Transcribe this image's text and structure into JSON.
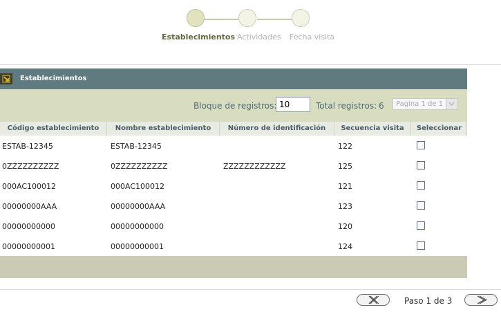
{
  "wizard": {
    "steps": [
      {
        "label": "Establecimientos",
        "state": "active"
      },
      {
        "label": "Actividades",
        "state": "inactive"
      },
      {
        "label": "Fecha visita",
        "state": "inactive"
      }
    ]
  },
  "panel": {
    "title": "Establecimientos",
    "icon": "expand-corner-icon"
  },
  "toolbar": {
    "block_label": "Bloque de registros:",
    "block_value": "10",
    "total_label": "Total registros:",
    "total_value": "6",
    "page_select": "Pagina 1 de 1"
  },
  "table": {
    "columns": [
      "Código establecimiento",
      "Nombre establecimiento",
      "Número de identificación",
      "Secuencia visita",
      "Seleccionar"
    ],
    "rows": [
      {
        "codigo": "ESTAB-12345",
        "nombre": "ESTAB-12345",
        "numero": "",
        "secuencia": "122",
        "checked": false
      },
      {
        "codigo": "0ZZZZZZZZZZ",
        "nombre": "0ZZZZZZZZZZ",
        "numero": "ZZZZZZZZZZZZ",
        "secuencia": "125",
        "checked": false
      },
      {
        "codigo": "000AC100012",
        "nombre": "000AC100012",
        "numero": "",
        "secuencia": "121",
        "checked": false
      },
      {
        "codigo": "00000000AAA",
        "nombre": "00000000AAA",
        "numero": "",
        "secuencia": "123",
        "checked": false
      },
      {
        "codigo": "00000000000",
        "nombre": "00000000000",
        "numero": "",
        "secuencia": "120",
        "checked": false
      },
      {
        "codigo": "00000000001",
        "nombre": "00000000001",
        "numero": "",
        "secuencia": "124",
        "checked": false
      }
    ]
  },
  "footer_nav": {
    "cancel_icon": "close-x-icon",
    "step_text": "Paso 1 de 3",
    "next_icon": "chevron-right-icon"
  },
  "colors": {
    "header_bg": "#5f7b80",
    "toolbar_bg": "#d9ddc0",
    "footer_bg": "#cbcbb5",
    "active_step": "#676740"
  }
}
